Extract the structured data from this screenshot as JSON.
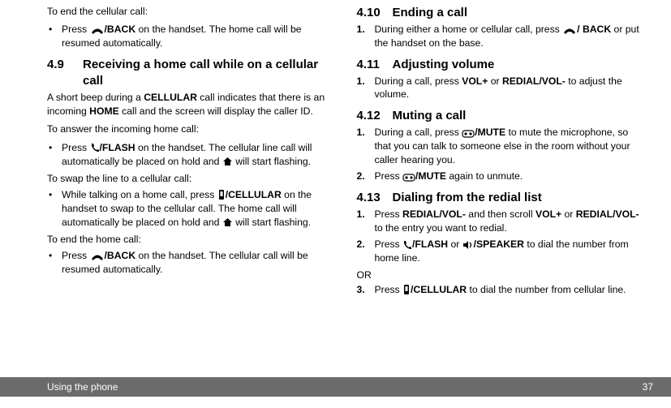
{
  "left": {
    "intro": "To end the cellular call:",
    "b1_a": "Press ",
    "b1_b": "/BACK",
    "b1_c": " on the handset. The home call will be resumed automatically.",
    "h49_num": "4.9",
    "h49_title": "Receiving a home call while on a cellular call",
    "p49a_a": "A short beep during a ",
    "p49a_b": "CELLULAR",
    "p49a_c": " call indicates that there is an incoming ",
    "p49a_d": "HOME",
    "p49a_e": " call and the screen will display the caller ID.",
    "p49b": "To answer the incoming home call:",
    "b2_a": "Press ",
    "b2_b": "/FLASH",
    "b2_c": " on the handset. The cellular line call will automatically be placed on hold and ",
    "b2_d": " will start flashing.",
    "p49c": "To swap the line to a cellular call:",
    "b3_a": "While talking on a home call, press ",
    "b3_b": "/CELLULAR",
    "b3_c": " on the handset to swap to the cellular call. The home call will automatically be placed on hold and ",
    "b3_d": " will start flashing.",
    "p49d": "To end the home call:",
    "b4_a": "Press ",
    "b4_b": "/BACK",
    "b4_c": " on the handset. The cellular call will be resumed automatically."
  },
  "right": {
    "h410_num": "4.10",
    "h410_title": "Ending a call",
    "r1n": "1.",
    "r1_a": "During either a home or cellular call, press ",
    "r1_b": "/ BACK",
    "r1_c": " or put the handset on the base.",
    "h411_num": "4.11",
    "h411_title": "Adjusting volume",
    "r2n": "1.",
    "r2_a": "During a call, press ",
    "r2_b": "VOL+",
    "r2_c": " or ",
    "r2_d": "REDIAL/VOL-",
    "r2_e": " to adjust the volume.",
    "h412_num": "4.12",
    "h412_title": "Muting a call",
    "r3n": "1.",
    "r3_a": "During a call, press ",
    "r3_b": "/MUTE",
    "r3_c": " to mute the microphone, so that you can talk to someone else in the room without your caller hearing you.",
    "r4n": "2.",
    "r4_a": "Press ",
    "r4_b": "/MUTE",
    "r4_c": " again to unmute.",
    "h413_num": "4.13",
    "h413_title": "Dialing from the redial list",
    "r5n": "1.",
    "r5_a": "Press ",
    "r5_b": "REDIAL/VOL-",
    "r5_c": " and then scroll ",
    "r5_d": "VOL+",
    "r5_e": " or ",
    "r5_f": "REDIAL/VOL-",
    "r5_g": " to the entry you want to redial.",
    "r6n": "2.",
    "r6_a": "Press ",
    "r6_b": "/FLASH",
    "r6_c": " or ",
    "r6_d": "/SPEAKER",
    "r6_e": " to dial the number from home line.",
    "or": "OR",
    "r7n": "3.",
    "r7_a": "Press ",
    "r7_b": "/CELLULAR",
    "r7_c": " to dial the number from cellular line."
  },
  "footer": {
    "title": "Using the phone",
    "page": "37"
  }
}
